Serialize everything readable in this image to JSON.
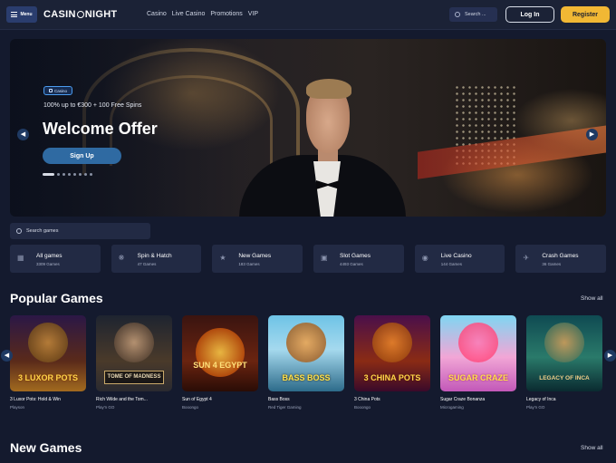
{
  "header": {
    "menu_label": "Menu",
    "logo_left": "CASIN",
    "logo_right": "NIGHT",
    "nav": [
      "Casino",
      "Live Casino",
      "Promotions",
      "VIP"
    ],
    "search_placeholder": "Search ...",
    "login_label": "Log In",
    "register_label": "Register"
  },
  "hero": {
    "badge": "Casino",
    "subtitle": "100% up to €300 + 100 Free Spins",
    "title": "Welcome Offer",
    "cta": "Sign Up",
    "slides_total": 8,
    "active_slide": 1
  },
  "search_games": {
    "placeholder": "Search games"
  },
  "categories": [
    {
      "name": "All games",
      "count": "3309 Games",
      "icon": "grid-icon"
    },
    {
      "name": "Spin & Hatch",
      "count": "47 Games",
      "icon": "sparkle-icon"
    },
    {
      "name": "New Games",
      "count": "183 Games",
      "icon": "star-icon"
    },
    {
      "name": "Slot Games",
      "count": "4493 Games",
      "icon": "slot-icon"
    },
    {
      "name": "Live Casino",
      "count": "144 Games",
      "icon": "live-icon"
    },
    {
      "name": "Crash Games",
      "count": "36 Games",
      "icon": "plane-icon"
    }
  ],
  "popular": {
    "title": "Popular Games",
    "show_all": "Show all",
    "games": [
      {
        "name": "3 Luxor Pots: Hold & Win",
        "provider": "Playson",
        "art": "3 LUXOR POTS"
      },
      {
        "name": "Rich Wilde and the Tom...",
        "provider": "Play'n GO",
        "art": "TOME OF MADNESS"
      },
      {
        "name": "Sun of Egypt 4",
        "provider": "Booongo",
        "art": "SUN 4 EGYPT"
      },
      {
        "name": "Bass Boss",
        "provider": "Red Tiger Gaming",
        "art": "BASS BOSS"
      },
      {
        "name": "3 China Pots",
        "provider": "Booongo",
        "art": "3 CHINA POTS"
      },
      {
        "name": "Sugar Craze Bonanza",
        "provider": "Microgaming",
        "art": "SUGAR CRAZE"
      },
      {
        "name": "Legacy of Inca",
        "provider": "Play'n GO",
        "art": "LEGACY OF INCA"
      }
    ]
  },
  "new_games": {
    "title": "New Games",
    "show_all": "Show all"
  }
}
